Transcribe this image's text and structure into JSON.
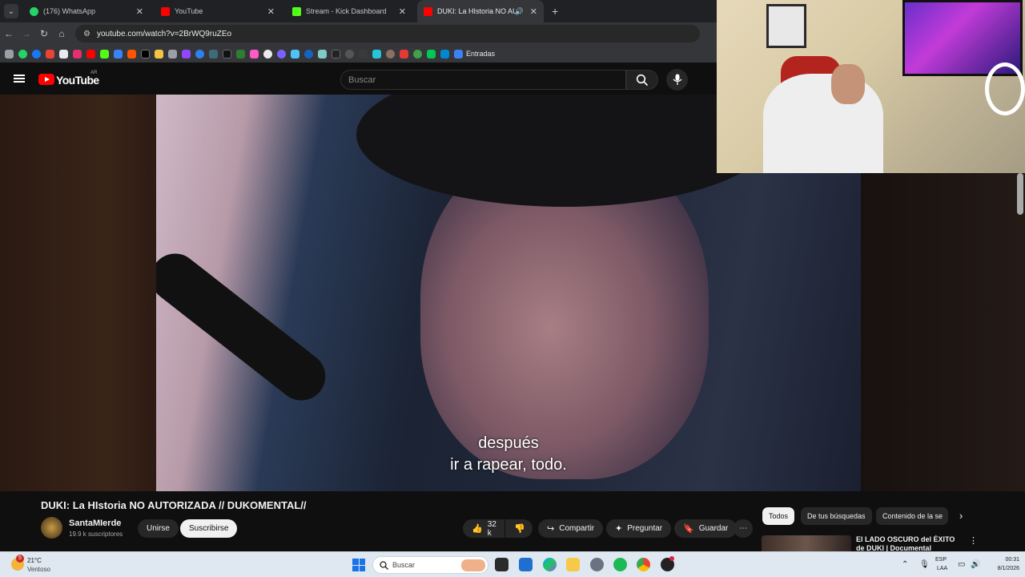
{
  "browser": {
    "tabs": [
      {
        "title": "(176) WhatsApp",
        "color": "#25d366",
        "active": false
      },
      {
        "title": "YouTube",
        "color": "#ff0000",
        "active": false
      },
      {
        "title": "Stream - Kick Dashboard",
        "color": "#53fc18",
        "active": false
      },
      {
        "title": "DUKI: La HIstoria NO AUTO",
        "color": "#ff0000",
        "active": true
      }
    ],
    "url": "youtube.com/watch?v=2BrWQ9ruZEo",
    "bookmarks_label": "Entradas"
  },
  "youtube": {
    "logo_text": "YouTube",
    "country_code": "AR",
    "search_placeholder": "Buscar",
    "subtitle_line1": "después",
    "subtitle_line2": "ir a rapear, todo.",
    "video_title": "DUKI: La HIstoria NO AUTORIZADA // DUKOMENTAL//",
    "channel_name": "SantaMIerde",
    "channel_subs": "19.9 k suscriptores",
    "join_label": "Unirse",
    "subscribe_label": "Suscribirse",
    "likes": "32 k",
    "share_label": "Compartir",
    "ask_label": "Preguntar",
    "save_label": "Guardar",
    "chips": [
      "Todos",
      "De tus búsquedas",
      "Contenido de la se"
    ],
    "related_title": "El LADO OSCURO del ÉXITO de DUKI | Documental"
  },
  "taskbar": {
    "weather_badge": "5",
    "temperature": "21°C",
    "weather_desc": "Ventoso",
    "search_label": "Buscar",
    "lang_top": "ESP",
    "lang_bottom": "LAA",
    "time": "00:31",
    "date": "8/1/2026"
  },
  "colors": {
    "yt_red": "#ff0000",
    "accent_blue": "#1a73e8"
  }
}
